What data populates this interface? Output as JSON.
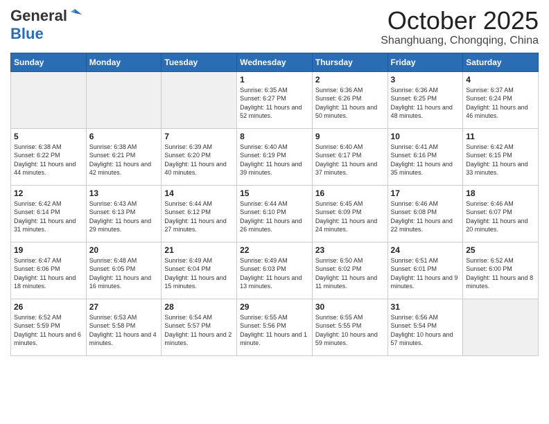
{
  "header": {
    "logo_general": "General",
    "logo_blue": "Blue",
    "month_title": "October 2025",
    "location": "Shanghuang, Chongqing, China"
  },
  "days_of_week": [
    "Sunday",
    "Monday",
    "Tuesday",
    "Wednesday",
    "Thursday",
    "Friday",
    "Saturday"
  ],
  "weeks": [
    [
      {
        "day": "",
        "sunrise": "",
        "sunset": "",
        "daylight": "",
        "empty": true
      },
      {
        "day": "",
        "sunrise": "",
        "sunset": "",
        "daylight": "",
        "empty": true
      },
      {
        "day": "",
        "sunrise": "",
        "sunset": "",
        "daylight": "",
        "empty": true
      },
      {
        "day": "1",
        "sunrise": "Sunrise: 6:35 AM",
        "sunset": "Sunset: 6:27 PM",
        "daylight": "Daylight: 11 hours and 52 minutes."
      },
      {
        "day": "2",
        "sunrise": "Sunrise: 6:36 AM",
        "sunset": "Sunset: 6:26 PM",
        "daylight": "Daylight: 11 hours and 50 minutes."
      },
      {
        "day": "3",
        "sunrise": "Sunrise: 6:36 AM",
        "sunset": "Sunset: 6:25 PM",
        "daylight": "Daylight: 11 hours and 48 minutes."
      },
      {
        "day": "4",
        "sunrise": "Sunrise: 6:37 AM",
        "sunset": "Sunset: 6:24 PM",
        "daylight": "Daylight: 11 hours and 46 minutes."
      }
    ],
    [
      {
        "day": "5",
        "sunrise": "Sunrise: 6:38 AM",
        "sunset": "Sunset: 6:22 PM",
        "daylight": "Daylight: 11 hours and 44 minutes."
      },
      {
        "day": "6",
        "sunrise": "Sunrise: 6:38 AM",
        "sunset": "Sunset: 6:21 PM",
        "daylight": "Daylight: 11 hours and 42 minutes."
      },
      {
        "day": "7",
        "sunrise": "Sunrise: 6:39 AM",
        "sunset": "Sunset: 6:20 PM",
        "daylight": "Daylight: 11 hours and 40 minutes."
      },
      {
        "day": "8",
        "sunrise": "Sunrise: 6:40 AM",
        "sunset": "Sunset: 6:19 PM",
        "daylight": "Daylight: 11 hours and 39 minutes."
      },
      {
        "day": "9",
        "sunrise": "Sunrise: 6:40 AM",
        "sunset": "Sunset: 6:17 PM",
        "daylight": "Daylight: 11 hours and 37 minutes."
      },
      {
        "day": "10",
        "sunrise": "Sunrise: 6:41 AM",
        "sunset": "Sunset: 6:16 PM",
        "daylight": "Daylight: 11 hours and 35 minutes."
      },
      {
        "day": "11",
        "sunrise": "Sunrise: 6:42 AM",
        "sunset": "Sunset: 6:15 PM",
        "daylight": "Daylight: 11 hours and 33 minutes."
      }
    ],
    [
      {
        "day": "12",
        "sunrise": "Sunrise: 6:42 AM",
        "sunset": "Sunset: 6:14 PM",
        "daylight": "Daylight: 11 hours and 31 minutes."
      },
      {
        "day": "13",
        "sunrise": "Sunrise: 6:43 AM",
        "sunset": "Sunset: 6:13 PM",
        "daylight": "Daylight: 11 hours and 29 minutes."
      },
      {
        "day": "14",
        "sunrise": "Sunrise: 6:44 AM",
        "sunset": "Sunset: 6:12 PM",
        "daylight": "Daylight: 11 hours and 27 minutes."
      },
      {
        "day": "15",
        "sunrise": "Sunrise: 6:44 AM",
        "sunset": "Sunset: 6:10 PM",
        "daylight": "Daylight: 11 hours and 26 minutes."
      },
      {
        "day": "16",
        "sunrise": "Sunrise: 6:45 AM",
        "sunset": "Sunset: 6:09 PM",
        "daylight": "Daylight: 11 hours and 24 minutes."
      },
      {
        "day": "17",
        "sunrise": "Sunrise: 6:46 AM",
        "sunset": "Sunset: 6:08 PM",
        "daylight": "Daylight: 11 hours and 22 minutes."
      },
      {
        "day": "18",
        "sunrise": "Sunrise: 6:46 AM",
        "sunset": "Sunset: 6:07 PM",
        "daylight": "Daylight: 11 hours and 20 minutes."
      }
    ],
    [
      {
        "day": "19",
        "sunrise": "Sunrise: 6:47 AM",
        "sunset": "Sunset: 6:06 PM",
        "daylight": "Daylight: 11 hours and 18 minutes."
      },
      {
        "day": "20",
        "sunrise": "Sunrise: 6:48 AM",
        "sunset": "Sunset: 6:05 PM",
        "daylight": "Daylight: 11 hours and 16 minutes."
      },
      {
        "day": "21",
        "sunrise": "Sunrise: 6:49 AM",
        "sunset": "Sunset: 6:04 PM",
        "daylight": "Daylight: 11 hours and 15 minutes."
      },
      {
        "day": "22",
        "sunrise": "Sunrise: 6:49 AM",
        "sunset": "Sunset: 6:03 PM",
        "daylight": "Daylight: 11 hours and 13 minutes."
      },
      {
        "day": "23",
        "sunrise": "Sunrise: 6:50 AM",
        "sunset": "Sunset: 6:02 PM",
        "daylight": "Daylight: 11 hours and 11 minutes."
      },
      {
        "day": "24",
        "sunrise": "Sunrise: 6:51 AM",
        "sunset": "Sunset: 6:01 PM",
        "daylight": "Daylight: 11 hours and 9 minutes."
      },
      {
        "day": "25",
        "sunrise": "Sunrise: 6:52 AM",
        "sunset": "Sunset: 6:00 PM",
        "daylight": "Daylight: 11 hours and 8 minutes."
      }
    ],
    [
      {
        "day": "26",
        "sunrise": "Sunrise: 6:52 AM",
        "sunset": "Sunset: 5:59 PM",
        "daylight": "Daylight: 11 hours and 6 minutes."
      },
      {
        "day": "27",
        "sunrise": "Sunrise: 6:53 AM",
        "sunset": "Sunset: 5:58 PM",
        "daylight": "Daylight: 11 hours and 4 minutes."
      },
      {
        "day": "28",
        "sunrise": "Sunrise: 6:54 AM",
        "sunset": "Sunset: 5:57 PM",
        "daylight": "Daylight: 11 hours and 2 minutes."
      },
      {
        "day": "29",
        "sunrise": "Sunrise: 6:55 AM",
        "sunset": "Sunset: 5:56 PM",
        "daylight": "Daylight: 11 hours and 1 minute."
      },
      {
        "day": "30",
        "sunrise": "Sunrise: 6:55 AM",
        "sunset": "Sunset: 5:55 PM",
        "daylight": "Daylight: 10 hours and 59 minutes."
      },
      {
        "day": "31",
        "sunrise": "Sunrise: 6:56 AM",
        "sunset": "Sunset: 5:54 PM",
        "daylight": "Daylight: 10 hours and 57 minutes."
      },
      {
        "day": "",
        "sunrise": "",
        "sunset": "",
        "daylight": "",
        "empty": true
      }
    ]
  ]
}
